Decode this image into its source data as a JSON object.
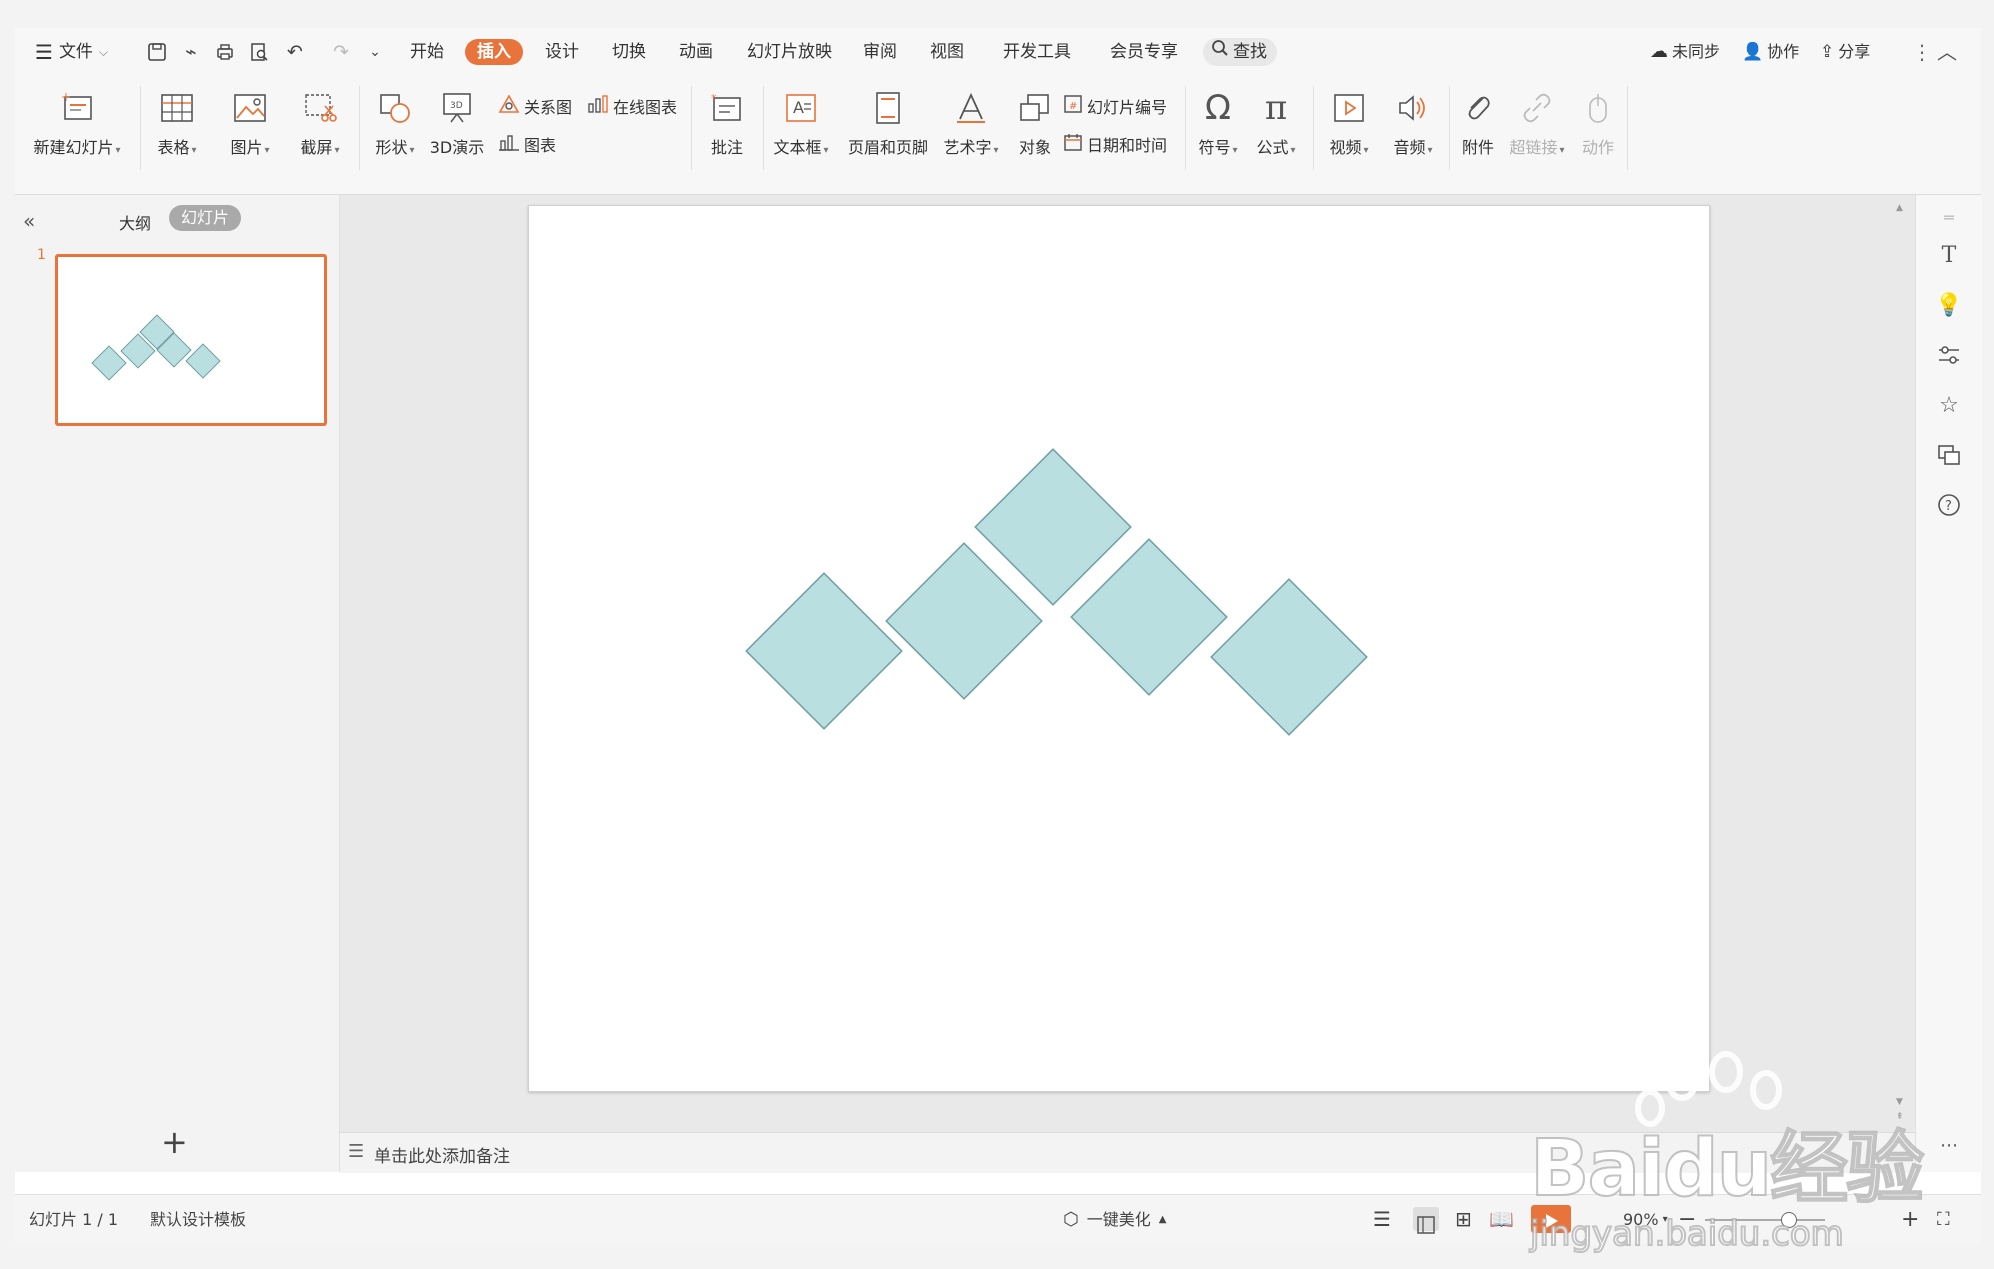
{
  "menu": {
    "file": "文件",
    "tabs": [
      "开始",
      "插入",
      "设计",
      "切换",
      "动画",
      "幻灯片放映",
      "审阅",
      "视图",
      "开发工具",
      "会员专享"
    ],
    "search": "查找",
    "sync": "未同步",
    "collab": "协作",
    "share": "分享"
  },
  "ribbon": {
    "new_slide": "新建幻灯片",
    "table": "表格",
    "picture": "图片",
    "screenshot": "截屏",
    "shape": "形状",
    "demo3d": "3D演示",
    "relation": "关系图",
    "online_chart": "在线图表",
    "chart": "图表",
    "comment": "批注",
    "textbox": "文本框",
    "header_footer": "页眉和页脚",
    "wordart": "艺术字",
    "object": "对象",
    "slide_number": "幻灯片编号",
    "datetime": "日期和时间",
    "symbol": "符号",
    "formula": "公式",
    "video": "视频",
    "audio": "音频",
    "attachment": "附件",
    "hyperlink": "超链接",
    "action": "动作"
  },
  "panel": {
    "outline_tab": "大纲",
    "slides_tab": "幻灯片",
    "slide_index": "1"
  },
  "notes_placeholder": "单击此处添加备注",
  "status": {
    "slide_info": "幻灯片 1 / 1",
    "template": "默认设计模板",
    "beautify": "一键美化",
    "zoom": "90%"
  },
  "watermark": "Baidu经验 jingyan.baidu.com",
  "colors": {
    "accent": "#e8743b",
    "diamond_fill": "#b9dfe1",
    "diamond_stroke": "#6f9ea3"
  }
}
